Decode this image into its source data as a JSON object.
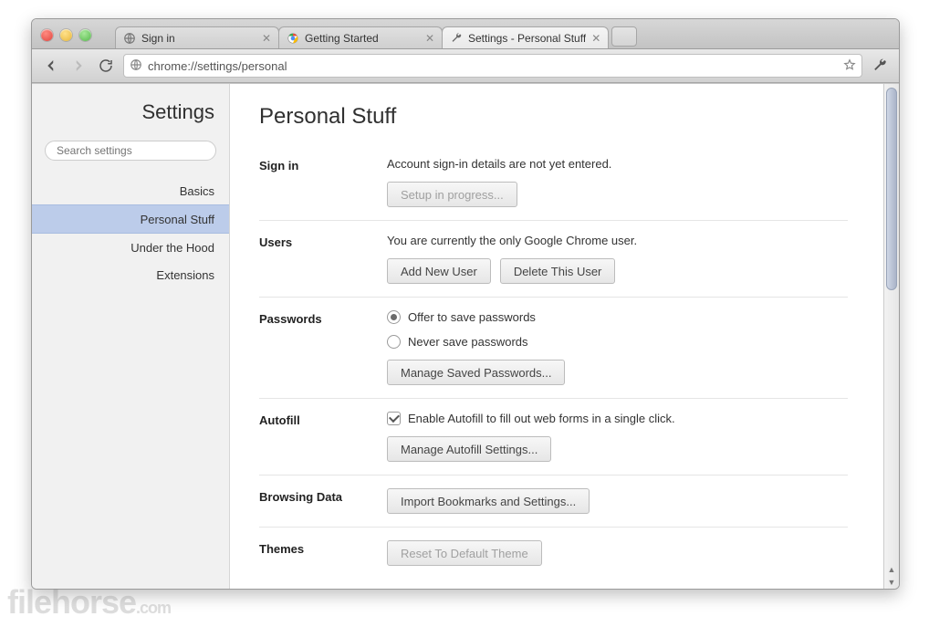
{
  "tabs": [
    {
      "title": "Sign in",
      "icon": "globe"
    },
    {
      "title": "Getting Started",
      "icon": "chrome"
    },
    {
      "title": "Settings - Personal Stuff",
      "icon": "wrench",
      "active": true
    }
  ],
  "url": "chrome://settings/personal",
  "sidebar": {
    "title": "Settings",
    "search_placeholder": "Search settings",
    "items": [
      {
        "label": "Basics"
      },
      {
        "label": "Personal Stuff",
        "selected": true
      },
      {
        "label": "Under the Hood"
      },
      {
        "label": "Extensions"
      }
    ]
  },
  "page_title": "Personal Stuff",
  "sections": {
    "sign_in": {
      "label": "Sign in",
      "desc": "Account sign-in details are not yet entered.",
      "button": "Setup in progress..."
    },
    "users": {
      "label": "Users",
      "desc": "You are currently the only Google Chrome user.",
      "buttons": {
        "add": "Add New User",
        "del": "Delete This User"
      }
    },
    "passwords": {
      "label": "Passwords",
      "offer": "Offer to save passwords",
      "never": "Never save passwords",
      "button": "Manage Saved Passwords..."
    },
    "autofill": {
      "label": "Autofill",
      "check": "Enable Autofill to fill out web forms in a single click.",
      "button": "Manage Autofill Settings..."
    },
    "browsing": {
      "label": "Browsing Data",
      "button": "Import Bookmarks and Settings..."
    },
    "themes": {
      "label": "Themes",
      "button": "Reset To Default Theme"
    }
  },
  "watermark": "filehorse",
  "watermark_tld": ".com"
}
